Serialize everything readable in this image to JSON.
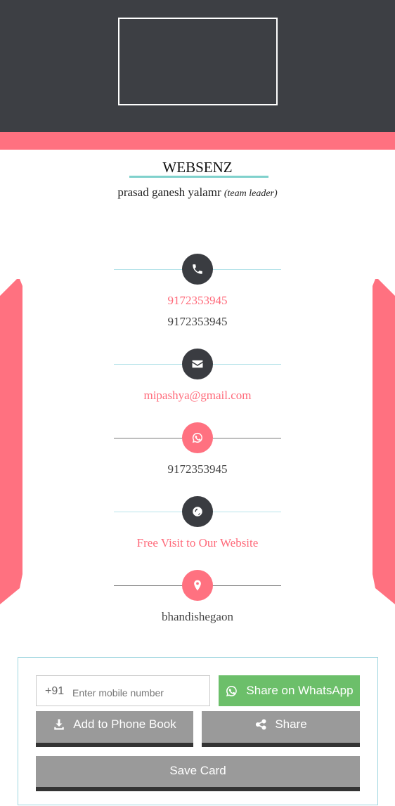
{
  "company": {
    "name": "WEBSENZ"
  },
  "person": {
    "name": "prasad ganesh yalamr",
    "role": "(team leader)"
  },
  "contact": {
    "phone_primary": "9172353945",
    "phone_secondary": "9172353945",
    "email": "mipashya@gmail.com",
    "whatsapp": "9172353945",
    "website_label": "Free Visit to Our Website",
    "address": "bhandishegaon"
  },
  "share_panel": {
    "country_code": "+91",
    "mobile_placeholder": "Enter mobile number",
    "whatsapp_label": "Share on WhatsApp",
    "phonebook_label": "Add to Phone Book",
    "share_label": "Share",
    "save_label": "Save Card"
  },
  "icons": {
    "phone": "phone-icon",
    "email": "envelope-icon",
    "whatsapp": "whatsapp-icon",
    "website": "globe-icon",
    "location": "map-pin-icon",
    "download": "download-icon",
    "share": "share-icon"
  },
  "colors": {
    "header": "#3d3f44",
    "accent_pink": "#ff7180",
    "accent_teal": "#7fd1cc",
    "whatsapp_green": "#6cbf6a",
    "button_gray": "#9a9a9a"
  }
}
